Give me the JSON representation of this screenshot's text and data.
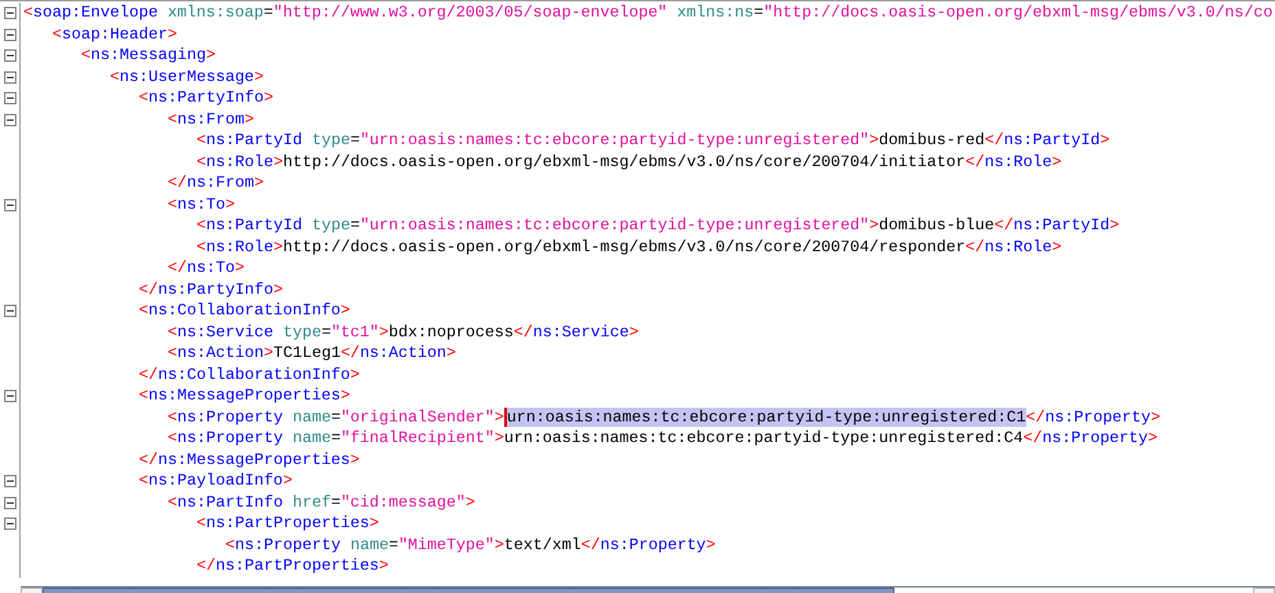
{
  "lines": [
    {
      "kind": "open",
      "expanded": true,
      "tokens": [
        {
          "kind": "punct",
          "text": "<"
        },
        {
          "kind": "tag",
          "text": "soap:Envelope "
        },
        {
          "kind": "attr",
          "text": "xmlns:soap"
        },
        {
          "kind": "text",
          "text": "=",
          "selected": false
        },
        {
          "kind": "value",
          "text": "\"http://www.w3.org/2003/05/soap-envelope\" "
        },
        {
          "kind": "attr",
          "text": "xmlns:ns"
        },
        {
          "kind": "text",
          "text": "=",
          "selected": false
        },
        {
          "kind": "value",
          "text": "\"http://docs.oasis-open.org/ebxml-msg/ebms/v3.0/ns/co"
        }
      ],
      "children": [
        {
          "kind": "open",
          "expanded": true,
          "tokens": [
            {
              "kind": "punct",
              "text": "<"
            },
            {
              "kind": "tag",
              "text": "soap:Header"
            },
            {
              "kind": "punct",
              "text": ">"
            }
          ],
          "children": [
            {
              "kind": "open",
              "expanded": true,
              "tokens": [
                {
                  "kind": "punct",
                  "text": "<"
                },
                {
                  "kind": "tag",
                  "text": "ns:Messaging"
                },
                {
                  "kind": "punct",
                  "text": ">"
                }
              ],
              "children": [
                {
                  "kind": "open",
                  "expanded": true,
                  "tokens": [
                    {
                      "kind": "punct",
                      "text": "<"
                    },
                    {
                      "kind": "tag",
                      "text": "ns:UserMessage"
                    },
                    {
                      "kind": "punct",
                      "text": ">"
                    }
                  ],
                  "children": [
                    {
                      "kind": "open",
                      "expanded": true,
                      "tokens": [
                        {
                          "kind": "punct",
                          "text": "<"
                        },
                        {
                          "kind": "tag",
                          "text": "ns:PartyInfo"
                        },
                        {
                          "kind": "punct",
                          "text": ">"
                        }
                      ],
                      "children": [
                        {
                          "kind": "open",
                          "expanded": true,
                          "tokens": [
                            {
                              "kind": "punct",
                              "text": "<"
                            },
                            {
                              "kind": "tag",
                              "text": "ns:From"
                            },
                            {
                              "kind": "punct",
                              "text": ">"
                            }
                          ],
                          "children": [
                            {
                              "kind": "leaf",
                              "tokens": [
                                {
                                  "kind": "punct",
                                  "text": "<"
                                },
                                {
                                  "kind": "tag",
                                  "text": "ns:PartyId "
                                },
                                {
                                  "kind": "attr",
                                  "text": "type"
                                },
                                {
                                  "kind": "text",
                                  "text": "=",
                                  "selected": false
                                },
                                {
                                  "kind": "value",
                                  "text": "\"urn:oasis:names:tc:ebcore:partyid-type:unregistered\""
                                },
                                {
                                  "kind": "punct",
                                  "text": ">"
                                },
                                {
                                  "kind": "text",
                                  "text": "domibus-red",
                                  "selected": false
                                },
                                {
                                  "kind": "punct",
                                  "text": "</"
                                },
                                {
                                  "kind": "tag",
                                  "text": "ns:PartyId"
                                },
                                {
                                  "kind": "punct",
                                  "text": ">"
                                }
                              ]
                            },
                            {
                              "kind": "leaf",
                              "tokens": [
                                {
                                  "kind": "punct",
                                  "text": "<"
                                },
                                {
                                  "kind": "tag",
                                  "text": "ns:Role"
                                },
                                {
                                  "kind": "punct",
                                  "text": ">"
                                },
                                {
                                  "kind": "text",
                                  "text": "http://docs.oasis-open.org/ebxml-msg/ebms/v3.0/ns/core/200704/initiator",
                                  "selected": false
                                },
                                {
                                  "kind": "punct",
                                  "text": "</"
                                },
                                {
                                  "kind": "tag",
                                  "text": "ns:Role"
                                },
                                {
                                  "kind": "punct",
                                  "text": ">"
                                }
                              ]
                            }
                          ]
                        },
                        {
                          "kind": "close",
                          "tokens": [
                            {
                              "kind": "punct",
                              "text": "</"
                            },
                            {
                              "kind": "tag",
                              "text": "ns:From"
                            },
                            {
                              "kind": "punct",
                              "text": ">"
                            }
                          ]
                        },
                        {
                          "kind": "open",
                          "expanded": true,
                          "tokens": [
                            {
                              "kind": "punct",
                              "text": "<"
                            },
                            {
                              "kind": "tag",
                              "text": "ns:To"
                            },
                            {
                              "kind": "punct",
                              "text": ">"
                            }
                          ],
                          "children": [
                            {
                              "kind": "leaf",
                              "tokens": [
                                {
                                  "kind": "punct",
                                  "text": "<"
                                },
                                {
                                  "kind": "tag",
                                  "text": "ns:PartyId "
                                },
                                {
                                  "kind": "attr",
                                  "text": "type"
                                },
                                {
                                  "kind": "text",
                                  "text": "=",
                                  "selected": false
                                },
                                {
                                  "kind": "value",
                                  "text": "\"urn:oasis:names:tc:ebcore:partyid-type:unregistered\""
                                },
                                {
                                  "kind": "punct",
                                  "text": ">"
                                },
                                {
                                  "kind": "text",
                                  "text": "domibus-blue",
                                  "selected": false
                                },
                                {
                                  "kind": "punct",
                                  "text": "</"
                                },
                                {
                                  "kind": "tag",
                                  "text": "ns:PartyId"
                                },
                                {
                                  "kind": "punct",
                                  "text": ">"
                                }
                              ]
                            },
                            {
                              "kind": "leaf",
                              "tokens": [
                                {
                                  "kind": "punct",
                                  "text": "<"
                                },
                                {
                                  "kind": "tag",
                                  "text": "ns:Role"
                                },
                                {
                                  "kind": "punct",
                                  "text": ">"
                                },
                                {
                                  "kind": "text",
                                  "text": "http://docs.oasis-open.org/ebxml-msg/ebms/v3.0/ns/core/200704/responder",
                                  "selected": false
                                },
                                {
                                  "kind": "punct",
                                  "text": "</"
                                },
                                {
                                  "kind": "tag",
                                  "text": "ns:Role"
                                },
                                {
                                  "kind": "punct",
                                  "text": ">"
                                }
                              ]
                            }
                          ]
                        },
                        {
                          "kind": "close",
                          "tokens": [
                            {
                              "kind": "punct",
                              "text": "</"
                            },
                            {
                              "kind": "tag",
                              "text": "ns:To"
                            },
                            {
                              "kind": "punct",
                              "text": ">"
                            }
                          ]
                        }
                      ]
                    },
                    {
                      "kind": "close",
                      "tokens": [
                        {
                          "kind": "punct",
                          "text": "</"
                        },
                        {
                          "kind": "tag",
                          "text": "ns:PartyInfo"
                        },
                        {
                          "kind": "punct",
                          "text": ">"
                        }
                      ]
                    },
                    {
                      "kind": "open",
                      "expanded": true,
                      "tokens": [
                        {
                          "kind": "punct",
                          "text": "<"
                        },
                        {
                          "kind": "tag",
                          "text": "ns:CollaborationInfo"
                        },
                        {
                          "kind": "punct",
                          "text": ">"
                        }
                      ],
                      "children": [
                        {
                          "kind": "leaf",
                          "tokens": [
                            {
                              "kind": "punct",
                              "text": "<"
                            },
                            {
                              "kind": "tag",
                              "text": "ns:Service "
                            },
                            {
                              "kind": "attr",
                              "text": "type"
                            },
                            {
                              "kind": "text",
                              "text": "=",
                              "selected": false
                            },
                            {
                              "kind": "value",
                              "text": "\"tc1\""
                            },
                            {
                              "kind": "punct",
                              "text": ">"
                            },
                            {
                              "kind": "text",
                              "text": "bdx:noprocess",
                              "selected": false
                            },
                            {
                              "kind": "punct",
                              "text": "</"
                            },
                            {
                              "kind": "tag",
                              "text": "ns:Service"
                            },
                            {
                              "kind": "punct",
                              "text": ">"
                            }
                          ]
                        },
                        {
                          "kind": "leaf",
                          "tokens": [
                            {
                              "kind": "punct",
                              "text": "<"
                            },
                            {
                              "kind": "tag",
                              "text": "ns:Action"
                            },
                            {
                              "kind": "punct",
                              "text": ">"
                            },
                            {
                              "kind": "text",
                              "text": "TC1Leg1",
                              "selected": false
                            },
                            {
                              "kind": "punct",
                              "text": "</"
                            },
                            {
                              "kind": "tag",
                              "text": "ns:Action"
                            },
                            {
                              "kind": "punct",
                              "text": ">"
                            }
                          ]
                        }
                      ]
                    },
                    {
                      "kind": "close",
                      "tokens": [
                        {
                          "kind": "punct",
                          "text": "</"
                        },
                        {
                          "kind": "tag",
                          "text": "ns:CollaborationInfo"
                        },
                        {
                          "kind": "punct",
                          "text": ">"
                        }
                      ]
                    },
                    {
                      "kind": "open",
                      "expanded": true,
                      "tokens": [
                        {
                          "kind": "punct",
                          "text": "<"
                        },
                        {
                          "kind": "tag",
                          "text": "ns:MessageProperties"
                        },
                        {
                          "kind": "punct",
                          "text": ">"
                        }
                      ],
                      "children": [
                        {
                          "kind": "leaf",
                          "tokens": [
                            {
                              "kind": "punct",
                              "text": "<"
                            },
                            {
                              "kind": "tag",
                              "text": "ns:Property "
                            },
                            {
                              "kind": "attr",
                              "text": "name"
                            },
                            {
                              "kind": "text",
                              "text": "=",
                              "selected": false
                            },
                            {
                              "kind": "value",
                              "text": "\"originalSender\""
                            },
                            {
                              "kind": "punct",
                              "text": ">"
                            },
                            {
                              "kind": "text",
                              "text": "urn:oasis:names:tc:ebcore:partyid-type:unregistered:C1",
                              "selected": true
                            },
                            {
                              "kind": "punct",
                              "text": "</"
                            },
                            {
                              "kind": "tag",
                              "text": "ns:Property"
                            },
                            {
                              "kind": "punct",
                              "text": ">"
                            }
                          ]
                        },
                        {
                          "kind": "leaf",
                          "tokens": [
                            {
                              "kind": "punct",
                              "text": "<"
                            },
                            {
                              "kind": "tag",
                              "text": "ns:Property "
                            },
                            {
                              "kind": "attr",
                              "text": "name"
                            },
                            {
                              "kind": "text",
                              "text": "=",
                              "selected": false
                            },
                            {
                              "kind": "value",
                              "text": "\"finalRecipient\""
                            },
                            {
                              "kind": "punct",
                              "text": ">"
                            },
                            {
                              "kind": "text",
                              "text": "urn:oasis:names:tc:ebcore:partyid-type:unregistered:C4",
                              "selected": false
                            },
                            {
                              "kind": "punct",
                              "text": "</"
                            },
                            {
                              "kind": "tag",
                              "text": "ns:Property"
                            },
                            {
                              "kind": "punct",
                              "text": ">"
                            }
                          ]
                        }
                      ]
                    },
                    {
                      "kind": "close",
                      "tokens": [
                        {
                          "kind": "punct",
                          "text": "</"
                        },
                        {
                          "kind": "tag",
                          "text": "ns:MessageProperties"
                        },
                        {
                          "kind": "punct",
                          "text": ">"
                        }
                      ]
                    },
                    {
                      "kind": "open",
                      "expanded": true,
                      "tokens": [
                        {
                          "kind": "punct",
                          "text": "<"
                        },
                        {
                          "kind": "tag",
                          "text": "ns:PayloadInfo"
                        },
                        {
                          "kind": "punct",
                          "text": ">"
                        }
                      ],
                      "children": [
                        {
                          "kind": "open",
                          "expanded": true,
                          "tokens": [
                            {
                              "kind": "punct",
                              "text": "<"
                            },
                            {
                              "kind": "tag",
                              "text": "ns:PartInfo "
                            },
                            {
                              "kind": "attr",
                              "text": "href"
                            },
                            {
                              "kind": "text",
                              "text": "=",
                              "selected": false
                            },
                            {
                              "kind": "value",
                              "text": "\"cid:message\""
                            },
                            {
                              "kind": "punct",
                              "text": ">"
                            }
                          ],
                          "children": [
                            {
                              "kind": "open",
                              "expanded": true,
                              "tokens": [
                                {
                                  "kind": "punct",
                                  "text": "<"
                                },
                                {
                                  "kind": "tag",
                                  "text": "ns:PartProperties"
                                },
                                {
                                  "kind": "punct",
                                  "text": ">"
                                }
                              ],
                              "children": [
                                {
                                  "kind": "leaf",
                                  "tokens": [
                                    {
                                      "kind": "punct",
                                      "text": "<"
                                    },
                                    {
                                      "kind": "tag",
                                      "text": "ns:Property "
                                    },
                                    {
                                      "kind": "attr",
                                      "text": "name"
                                    },
                                    {
                                      "kind": "text",
                                      "text": "=",
                                      "selected": false
                                    },
                                    {
                                      "kind": "value",
                                      "text": "\"MimeType\""
                                    },
                                    {
                                      "kind": "punct",
                                      "text": ">"
                                    },
                                    {
                                      "kind": "text",
                                      "text": "text/xml",
                                      "selected": false
                                    },
                                    {
                                      "kind": "punct",
                                      "text": "</"
                                    },
                                    {
                                      "kind": "tag",
                                      "text": "ns:Property"
                                    },
                                    {
                                      "kind": "punct",
                                      "text": ">"
                                    }
                                  ]
                                }
                              ]
                            },
                            {
                              "kind": "close",
                              "tokens": [
                                {
                                  "kind": "punct",
                                  "text": "</"
                                },
                                {
                                  "kind": "tag",
                                  "text": "ns:PartProperties"
                                },
                                {
                                  "kind": "punct",
                                  "text": ">"
                                }
                              ]
                            }
                          ]
                        }
                      ]
                    }
                  ]
                }
              ]
            }
          ]
        }
      ]
    }
  ]
}
